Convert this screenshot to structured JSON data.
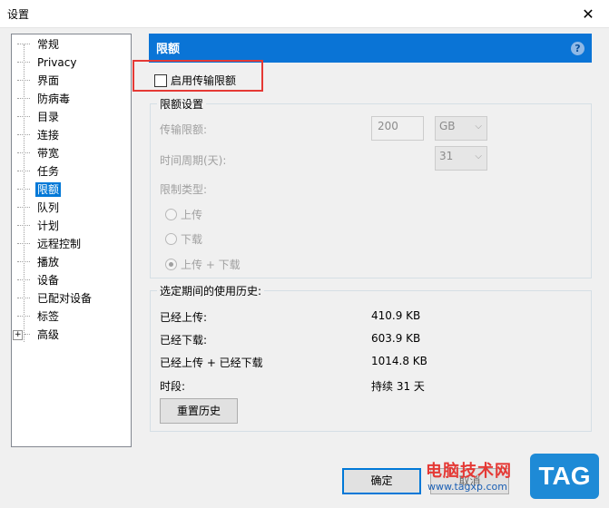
{
  "window": {
    "title": "设置",
    "close_glyph": "✕"
  },
  "tree": {
    "items": [
      {
        "label": "常规"
      },
      {
        "label": "Privacy"
      },
      {
        "label": "界面"
      },
      {
        "label": "防病毒"
      },
      {
        "label": "目录"
      },
      {
        "label": "连接"
      },
      {
        "label": "带宽"
      },
      {
        "label": "任务"
      },
      {
        "label": "限额",
        "selected": true
      },
      {
        "label": "队列"
      },
      {
        "label": "计划"
      },
      {
        "label": "远程控制"
      },
      {
        "label": "播放"
      },
      {
        "label": "设备"
      },
      {
        "label": "已配对设备"
      },
      {
        "label": "标签"
      },
      {
        "label": "高级",
        "expandable": true
      }
    ]
  },
  "panel": {
    "header_title": "限额",
    "help_glyph": "?",
    "enable_label": "启用传输限额",
    "enable_checked": false,
    "settings_group": {
      "legend": "限额设置",
      "transfer_limit_label": "传输限额:",
      "transfer_limit_value": "200",
      "transfer_unit": "GB",
      "period_label": "时间周期(天):",
      "period_value": "31",
      "limit_type_label": "限制类型:",
      "options": [
        "上传",
        "下载",
        "上传 + 下载"
      ],
      "selected_option": "上传 + 下载"
    },
    "history_group": {
      "legend": "选定期间的使用历史:",
      "uploaded_label": "已经上传:",
      "uploaded_value": "410.9 KB",
      "downloaded_label": "已经下载:",
      "downloaded_value": "603.9 KB",
      "total_label": "已经上传 + 已经下载",
      "total_value": "1014.8 KB",
      "period_label": "时段:",
      "period_value": "持续 31 天",
      "reset_button": "重置历史"
    }
  },
  "footer": {
    "ok_button": "确定",
    "cancel_button": "取消"
  },
  "watermark": {
    "site_name": "电脑技术网",
    "site_url": "www.tagxp.com",
    "logo_text": "TAG"
  },
  "colors": {
    "accent": "#0a74d6",
    "highlight_box": "#e53935",
    "selection": "#0078d7"
  }
}
